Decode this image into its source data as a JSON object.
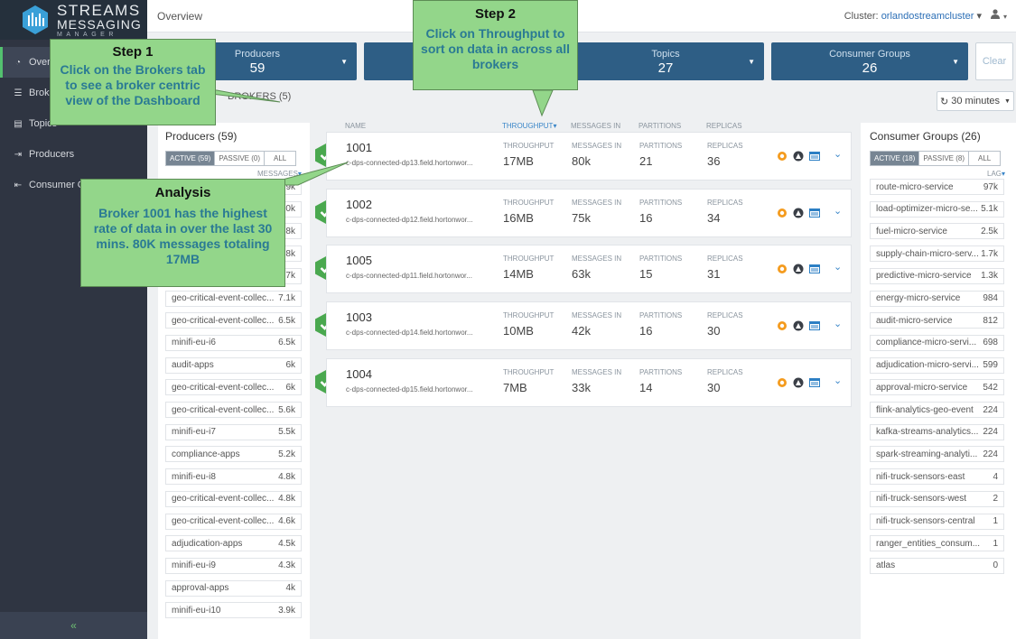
{
  "app": {
    "logo_line1": "STREAMS",
    "logo_line2": "MESSAGING",
    "logo_line3": "MANAGER"
  },
  "sidebar": {
    "items": [
      {
        "label": "Overview",
        "icon": "dashboard-icon"
      },
      {
        "label": "Brokers",
        "icon": "server-icon"
      },
      {
        "label": "Topics",
        "icon": "database-icon"
      },
      {
        "label": "Producers",
        "icon": "sign-out-icon"
      },
      {
        "label": "Consumer Groups",
        "icon": "sign-in-icon"
      }
    ],
    "collapse": "«"
  },
  "header": {
    "title": "Overview",
    "cluster_label": "Cluster:",
    "cluster_name": "orlandostreamcluster",
    "caret": "▾",
    "user_icon": "user-icon"
  },
  "summary_cards": [
    {
      "label": "Producers",
      "value": "59"
    },
    {
      "label": "",
      "value": ""
    },
    {
      "label": "Topics",
      "value": "27"
    },
    {
      "label": "Consumer Groups",
      "value": "26"
    }
  ],
  "clear_button": "Clear",
  "brokers_tab": "BROKERS (5)",
  "time_range": "30 minutes",
  "producers": {
    "title": "Producers (59)",
    "filters": [
      "ACTIVE (59)",
      "PASSIVE (0)",
      "ALL"
    ],
    "sort_label": "MESSAGES",
    "rows": [
      {
        "name": "",
        "value": "9k"
      },
      {
        "name": "",
        "value": "20k"
      },
      {
        "name": "",
        "value": "9.8k"
      },
      {
        "name": "",
        "value": "9.8k"
      },
      {
        "name": "geo-critical-event-collec...",
        "value": "7.7k"
      },
      {
        "name": "geo-critical-event-collec...",
        "value": "7.1k"
      },
      {
        "name": "geo-critical-event-collec...",
        "value": "6.5k"
      },
      {
        "name": "minifi-eu-i6",
        "value": "6.5k"
      },
      {
        "name": "audit-apps",
        "value": "6k"
      },
      {
        "name": "geo-critical-event-collec...",
        "value": "6k"
      },
      {
        "name": "geo-critical-event-collec...",
        "value": "5.6k"
      },
      {
        "name": "minifi-eu-i7",
        "value": "5.5k"
      },
      {
        "name": "compliance-apps",
        "value": "5.2k"
      },
      {
        "name": "minifi-eu-i8",
        "value": "4.8k"
      },
      {
        "name": "geo-critical-event-collec...",
        "value": "4.8k"
      },
      {
        "name": "geo-critical-event-collec...",
        "value": "4.6k"
      },
      {
        "name": "adjudication-apps",
        "value": "4.5k"
      },
      {
        "name": "minifi-eu-i9",
        "value": "4.3k"
      },
      {
        "name": "approval-apps",
        "value": "4k"
      },
      {
        "name": "minifi-eu-i10",
        "value": "3.9k"
      }
    ]
  },
  "broker_columns": {
    "name": "NAME",
    "throughput": "THROUGHPUT",
    "messages_in": "MESSAGES IN",
    "partitions": "PARTITIONS",
    "replicas": "REPLICAS",
    "sort_caret": "▾"
  },
  "brokers": [
    {
      "id": "1001",
      "host": "c-dps-connected-dp13.field.hortonwor...",
      "throughput": "17MB",
      "messages_in": "80k",
      "partitions": "21",
      "replicas": "36"
    },
    {
      "id": "1002",
      "host": "c-dps-connected-dp12.field.hortonwor...",
      "throughput": "16MB",
      "messages_in": "75k",
      "partitions": "16",
      "replicas": "34"
    },
    {
      "id": "1005",
      "host": "c-dps-connected-dp11.field.hortonwor...",
      "throughput": "14MB",
      "messages_in": "63k",
      "partitions": "15",
      "replicas": "31"
    },
    {
      "id": "1003",
      "host": "c-dps-connected-dp14.field.hortonwor...",
      "throughput": "10MB",
      "messages_in": "42k",
      "partitions": "16",
      "replicas": "30"
    },
    {
      "id": "1004",
      "host": "c-dps-connected-dp15.field.hortonwor...",
      "throughput": "7MB",
      "messages_in": "33k",
      "partitions": "14",
      "replicas": "30"
    }
  ],
  "consumer_groups": {
    "title": "Consumer Groups (26)",
    "filters": [
      "ACTIVE (18)",
      "PASSIVE (8)",
      "ALL"
    ],
    "sort_label": "LAG",
    "rows": [
      {
        "name": "route-micro-service",
        "value": "97k"
      },
      {
        "name": "load-optimizer-micro-se...",
        "value": "5.1k"
      },
      {
        "name": "fuel-micro-service",
        "value": "2.5k"
      },
      {
        "name": "supply-chain-micro-serv...",
        "value": "1.7k"
      },
      {
        "name": "predictive-micro-service",
        "value": "1.3k"
      },
      {
        "name": "energy-micro-service",
        "value": "984"
      },
      {
        "name": "audit-micro-service",
        "value": "812"
      },
      {
        "name": "compliance-micro-servi...",
        "value": "698"
      },
      {
        "name": "adjudication-micro-servi...",
        "value": "599"
      },
      {
        "name": "approval-micro-service",
        "value": "542"
      },
      {
        "name": "flink-analytics-geo-event",
        "value": "224"
      },
      {
        "name": "kafka-streams-analytics...",
        "value": "224"
      },
      {
        "name": "spark-streaming-analyti...",
        "value": "224"
      },
      {
        "name": "nifi-truck-sensors-east",
        "value": "4"
      },
      {
        "name": "nifi-truck-sensors-west",
        "value": "2"
      },
      {
        "name": "nifi-truck-sensors-central",
        "value": "1"
      },
      {
        "name": "ranger_entities_consum...",
        "value": "1"
      },
      {
        "name": "atlas",
        "value": "0"
      }
    ]
  },
  "callouts": {
    "step1": {
      "title": "Step 1",
      "body": "Click on the Brokers tab to see a broker centric view of the Dashboard"
    },
    "step2": {
      "title": "Step 2",
      "body": "Click on Throughput to sort on data in across all brokers"
    },
    "analysis": {
      "title": "Analysis",
      "body": "Broker 1001 has the highest rate of data in over the last 30 mins. 80K messages totaling 17MB"
    }
  },
  "colors": {
    "sidebar_bg": "#2f3542",
    "card_bg": "#2e5e85",
    "callout_bg": "#93d68a",
    "callout_text": "#2a7a94",
    "status_green": "#4aa84f",
    "link_blue": "#3a86c8"
  }
}
